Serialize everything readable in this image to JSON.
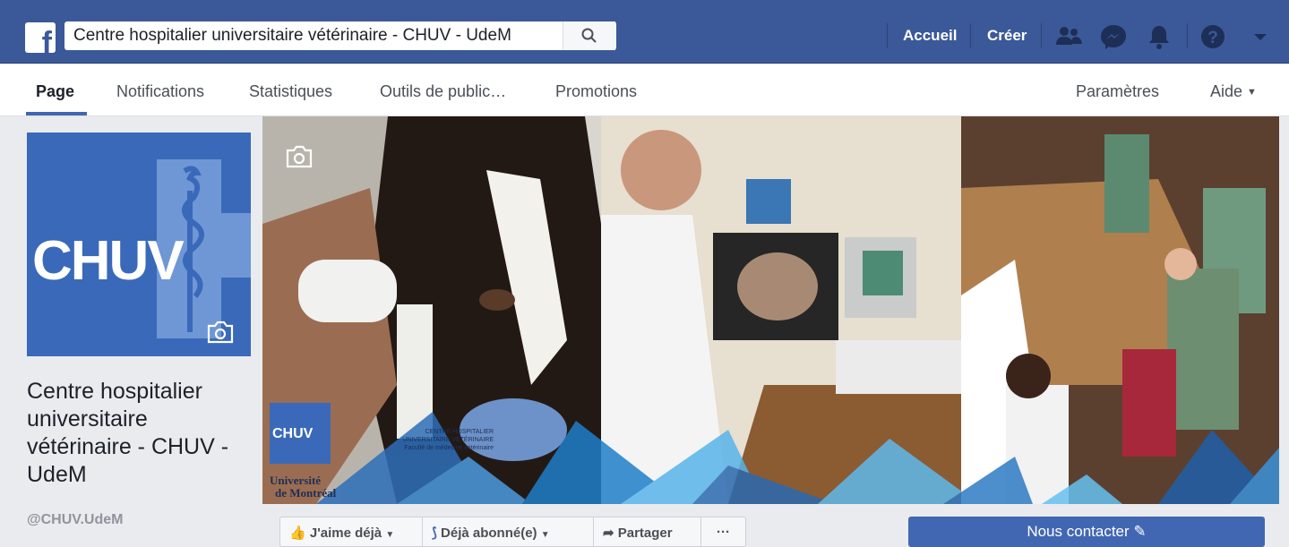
{
  "topbar": {
    "logo_letter": "f",
    "search_value": "Centre hospitalier universitaire vétérinaire - CHUV - UdeM",
    "home_label": "Accueil",
    "create_label": "Créer",
    "icons": [
      "friends-icon",
      "messenger-icon",
      "bell-icon",
      "help-icon",
      "caret-down-icon"
    ]
  },
  "tabs": [
    {
      "label": "Page",
      "active": true
    },
    {
      "label": "Notifications"
    },
    {
      "label": "Statistiques"
    },
    {
      "label": "Outils de public…"
    },
    {
      "label": "Promotions"
    }
  ],
  "right_tabs": {
    "settings": "Paramètres",
    "help": "Aide"
  },
  "profile": {
    "logo_text": "CHUV",
    "name": "Centre hospitalier universitaire vétérinaire - CHUV - UdeM",
    "handle": "@CHUV.UdeM"
  },
  "cover": {
    "overlay_chuv": "CHUV",
    "overlay_line1": "CENTRE HOSPITALIER",
    "overlay_line2": "UNIVERSITAIRE VÉTÉRINAIRE",
    "overlay_line3": "Faculté de médecine vétérinaire",
    "overlay_univ1": "Université",
    "overlay_univ2": "de Montréal"
  },
  "actions": {
    "like": "J'aime déjà",
    "follow": "Déjà abonné(e)",
    "share": "Partager",
    "more": "···",
    "contact": "Nous contacter"
  },
  "colors": {
    "brand": "#3b5998",
    "accent": "#4267b2",
    "logo_blue": "#3a69b9"
  }
}
